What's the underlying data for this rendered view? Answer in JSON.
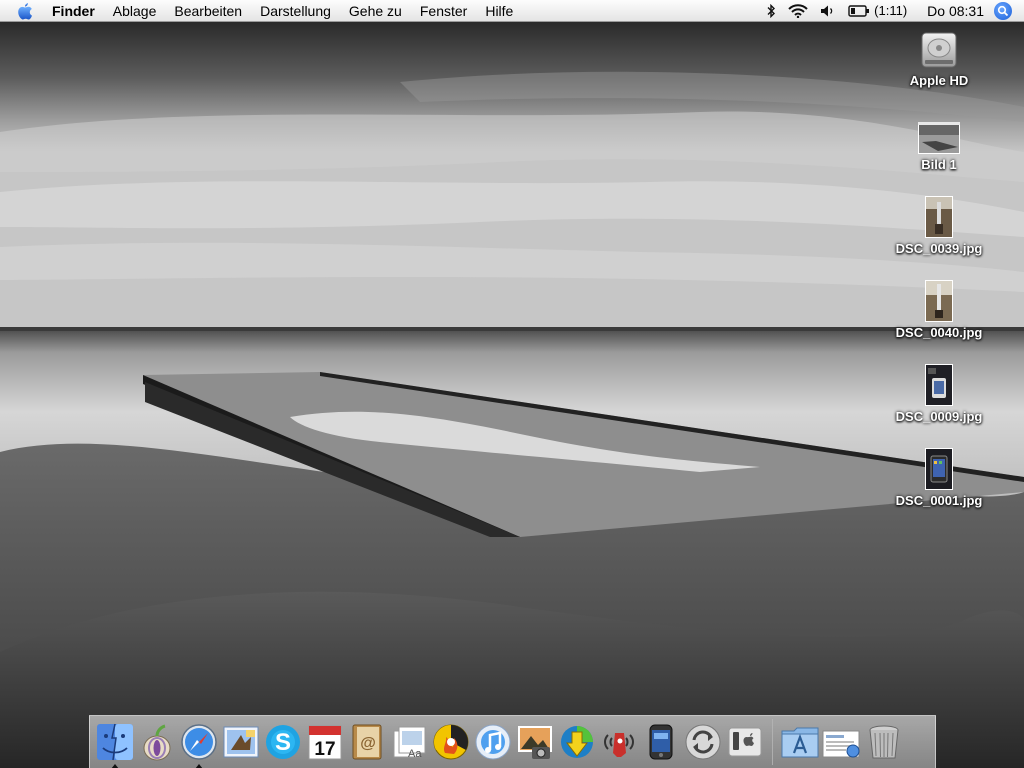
{
  "menubar": {
    "app": "Finder",
    "menus": [
      "Ablage",
      "Bearbeiten",
      "Darstellung",
      "Gehe zu",
      "Fenster",
      "Hilfe"
    ],
    "battery": "(1:11)",
    "clock": "Do 08:31"
  },
  "desktop_icons": [
    {
      "label": "Apple HD",
      "icon": "hard-drive-icon"
    },
    {
      "label": "Bild 1",
      "icon": "screenshot-thumbnail-icon"
    },
    {
      "label": "DSC_0039.jpg",
      "icon": "photo-thumbnail-icon"
    },
    {
      "label": "DSC_0040.jpg",
      "icon": "photo-thumbnail-icon"
    },
    {
      "label": "DSC_0009.jpg",
      "icon": "photo-thumbnail-icon"
    },
    {
      "label": "DSC_0001.jpg",
      "icon": "photo-thumbnail-icon"
    }
  ],
  "dock": {
    "apps": [
      "finder-icon",
      "tor-icon",
      "safari-icon",
      "mail-icon",
      "skype-icon",
      "ical-icon",
      "address-book-icon",
      "preview-icon",
      "burn-icon",
      "itunes-icon",
      "iphoto-icon",
      "downloader-icon",
      "signal-icon",
      "iphone-app-icon",
      "sync-icon",
      "iphone-config-icon"
    ],
    "ical_day": "17",
    "right": [
      "applications-folder-icon",
      "documents-stack-icon",
      "trash-icon"
    ]
  }
}
